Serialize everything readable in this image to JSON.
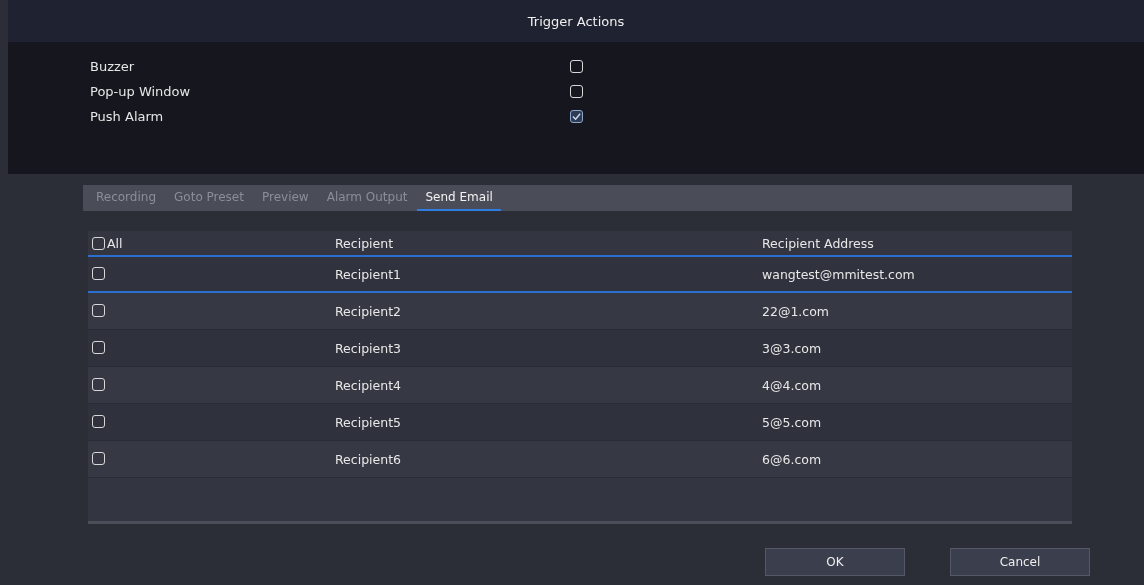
{
  "window": {
    "title": "Trigger Actions"
  },
  "options": [
    {
      "label": "Buzzer",
      "checked": false
    },
    {
      "label": "Pop-up Window",
      "checked": false
    },
    {
      "label": "Push Alarm",
      "checked": true
    }
  ],
  "tabs": [
    {
      "label": "Recording",
      "selected": false
    },
    {
      "label": "Goto Preset",
      "selected": false
    },
    {
      "label": "Preview",
      "selected": false
    },
    {
      "label": "Alarm Output",
      "selected": false
    },
    {
      "label": "Send Email",
      "selected": true
    }
  ],
  "table": {
    "select_all": {
      "label": "All",
      "checked": false
    },
    "columns": [
      "Recipient",
      "Recipient Address"
    ],
    "rows": [
      {
        "checked": false,
        "selected": true,
        "name": "Recipient1",
        "address": "wangtest@mmitest.com"
      },
      {
        "checked": false,
        "selected": false,
        "name": "Recipient2",
        "address": "22@1.com"
      },
      {
        "checked": false,
        "selected": false,
        "name": "Recipient3",
        "address": "3@3.com"
      },
      {
        "checked": false,
        "selected": false,
        "name": "Recipient4",
        "address": "4@4.com"
      },
      {
        "checked": false,
        "selected": false,
        "name": "Recipient5",
        "address": "5@5.com"
      },
      {
        "checked": false,
        "selected": false,
        "name": "Recipient6",
        "address": "6@6.com"
      }
    ]
  },
  "buttons": [
    "OK",
    "Cancel"
  ]
}
